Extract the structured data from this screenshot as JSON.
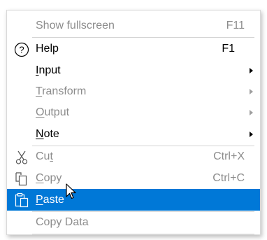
{
  "menu": {
    "items": [
      {
        "label": "Show fullscreen",
        "shortcut": "F11"
      },
      {
        "label": "Help",
        "shortcut": "F1",
        "icon": "help-circle-icon"
      },
      {
        "label_pre": "",
        "label_u": "I",
        "label_post": "nput",
        "submenu": true
      },
      {
        "label_pre": "",
        "label_u": "T",
        "label_post": "ransform",
        "submenu": true
      },
      {
        "label_pre": "",
        "label_u": "O",
        "label_post": "utput",
        "submenu": true
      },
      {
        "label_pre": "",
        "label_u": "N",
        "label_post": "ote",
        "submenu": true
      },
      {
        "label_pre": "Cu",
        "label_u": "t",
        "label_post": "",
        "shortcut": "Ctrl+X",
        "icon": "scissors-icon"
      },
      {
        "label_pre": "",
        "label_u": "C",
        "label_post": "opy",
        "shortcut": "Ctrl+C",
        "icon": "copy-icon"
      },
      {
        "label_pre": "",
        "label_u": "P",
        "label_post": "aste",
        "icon": "clipboard-icon",
        "selected": true
      },
      {
        "label": "Copy Data"
      }
    ]
  },
  "colors": {
    "selection": "#0078d7",
    "disabled_text": "#8c8c8c",
    "separator": "#d4d4d4"
  }
}
